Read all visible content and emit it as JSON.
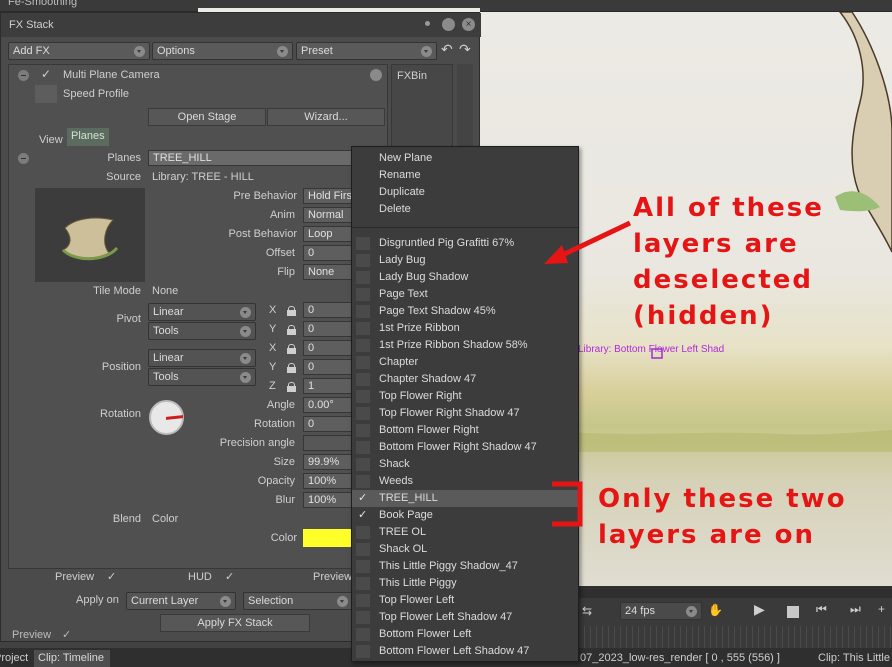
{
  "background": {
    "top_left_title": "Fe-Smoothing",
    "preview_label": "Preview",
    "project_tab": "Project",
    "clip_timeline_tab": "Clip: Timeline"
  },
  "fx_stack": {
    "title": "FX Stack",
    "add_fx": "Add FX",
    "options": "Options",
    "preset": "Preset",
    "fxbin": "FXBin",
    "effect_name": "Multi Plane Camera",
    "speed_profile": "Speed Profile",
    "open_stage": "Open Stage",
    "wizard": "Wizard...",
    "tab_view": "View",
    "tab_planes": "Planes",
    "planes_label": "Planes",
    "planes_value": "TREE_HILL",
    "source_label": "Source",
    "source_value": "Library: TREE - HILL",
    "pre_behavior_label": "Pre Behavior",
    "pre_behavior_value": "Hold Firs",
    "anim_label": "Anim",
    "anim_value": "Normal",
    "post_behavior_label": "Post Behavior",
    "post_behavior_value": "Loop",
    "offset_label": "Offset",
    "offset_value": "0",
    "flip_label": "Flip",
    "flip_value": "None",
    "tile_mode_label": "Tile Mode",
    "tile_mode_value": "None",
    "pivot_label": "Pivot",
    "pivot_interp": "Linear",
    "pivot_tools": "Tools",
    "pivot_x": "0",
    "pivot_y": "0",
    "position_label": "Position",
    "position_interp": "Linear",
    "position_tools": "Tools",
    "position_x": "0",
    "position_y": "0",
    "position_z": "1",
    "x_label": "X",
    "y_label": "Y",
    "z_label": "Z",
    "rotation_label": "Rotation",
    "angle_label": "Angle",
    "angle_value": "0.00°",
    "rotation_field_label": "Rotation",
    "rotation_value": "0",
    "precision_angle_label": "Precision angle",
    "size_label": "Size",
    "size_value": "99.9%",
    "opacity_label": "Opacity",
    "opacity_value": "100%",
    "blur_label": "Blur",
    "blur_value": "100%",
    "blend_label": "Blend",
    "blend_value": "Color",
    "color_label": "Color",
    "color_swatch": "#ffff2a",
    "preview_label": "Preview",
    "hud_label": "HUD",
    "preview2_label": "Preview",
    "apply_on_label": "Apply on",
    "apply_on_value": "Current Layer",
    "selection_value": "Selection",
    "apply_button": "Apply FX Stack"
  },
  "menu": {
    "actions": [
      "New Plane",
      "Rename",
      "Duplicate",
      "Delete"
    ],
    "layers": [
      {
        "label": "Disgruntled Pig Grafitti  67%",
        "checked": false
      },
      {
        "label": "Lady Bug",
        "checked": false
      },
      {
        "label": "Lady Bug Shadow",
        "checked": false
      },
      {
        "label": "Page Text",
        "checked": false
      },
      {
        "label": "Page Text Shadow 45%",
        "checked": false
      },
      {
        "label": "1st Prize Ribbon",
        "checked": false
      },
      {
        "label": "1st Prize Ribbon Shadow 58%",
        "checked": false
      },
      {
        "label": "Chapter",
        "checked": false
      },
      {
        "label": "Chapter Shadow 47",
        "checked": false
      },
      {
        "label": "Top Flower Right",
        "checked": false
      },
      {
        "label": "Top Flower Right Shadow 47",
        "checked": false
      },
      {
        "label": "Bottom Flower Right",
        "checked": false
      },
      {
        "label": "Bottom Flower Right Shadow 47",
        "checked": false
      },
      {
        "label": "Shack",
        "checked": false
      },
      {
        "label": "Weeds",
        "checked": false
      },
      {
        "label": "TREE_HILL",
        "checked": true
      },
      {
        "label": "Book Page",
        "checked": true
      },
      {
        "label": "TREE OL",
        "checked": false
      },
      {
        "label": "Shack OL",
        "checked": false
      },
      {
        "label": "This Little Piggy Shadow_47",
        "checked": false
      },
      {
        "label": "This Little Piggy",
        "checked": false
      },
      {
        "label": "Top Flower Left",
        "checked": false
      },
      {
        "label": "Top Flower Left Shadow 47",
        "checked": false
      },
      {
        "label": "Bottom Flower Left",
        "checked": false
      },
      {
        "label": "Bottom Flower Left Shadow 47",
        "checked": false
      }
    ]
  },
  "annotations": {
    "deselected": [
      "All of these",
      "layers are",
      "deselected",
      "(hidden)"
    ],
    "only_two": [
      "Only these two",
      "layers are on"
    ],
    "accent": "#e51515"
  },
  "canvas": {
    "overlay_text": "Library: Bottom Flower Left Shad"
  },
  "timeline": {
    "fps": "24 fps",
    "status_text": "07_2023_low-res_render [ 0 , 555  (556) ]",
    "clip_label": "Clip: This Little"
  }
}
